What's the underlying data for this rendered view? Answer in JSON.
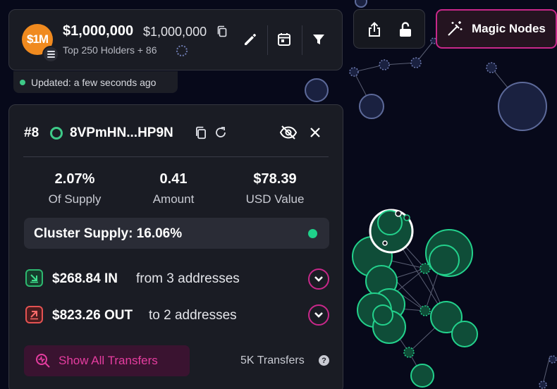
{
  "token": {
    "logo_text": "$1M",
    "market_cap": "$1,000,000",
    "market_cap_secondary": "$1,000,000",
    "holders_label": "Top 250 Holders + 86"
  },
  "status": {
    "updated": "Updated: a few seconds ago"
  },
  "toolbar": {
    "magic_nodes_label": "Magic Nodes"
  },
  "holder": {
    "rank": "#8",
    "address": "8VPmHN...HP9N",
    "stats": [
      {
        "value": "2.07%",
        "label": "Of Supply"
      },
      {
        "value": "0.41",
        "label": "Amount"
      },
      {
        "value": "$78.39",
        "label": "USD Value"
      }
    ],
    "cluster_supply": "Cluster Supply: 16.06%",
    "inflow": {
      "amount": "$268.84 IN",
      "description": "from 3 addresses"
    },
    "outflow": {
      "amount": "$823.26 OUT",
      "description": "to 2 addresses"
    },
    "show_transfers_label": "Show All Transfers",
    "transfers_count": "5K Transfers"
  },
  "colors": {
    "accent": "#c8288a",
    "positive": "#1fd18a",
    "negative": "#e45252",
    "token_orange": "#f08a1f"
  }
}
